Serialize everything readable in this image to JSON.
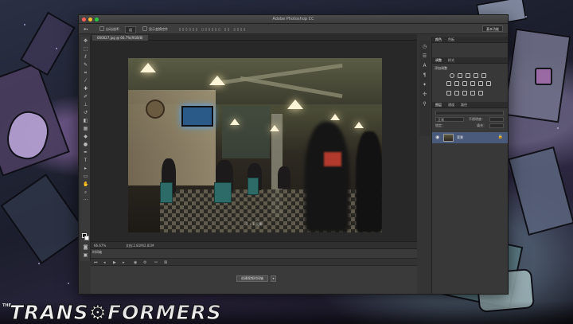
{
  "app": {
    "title": "Adobe Photoshop CC"
  },
  "options_bar": {
    "auto_select_label": "自动选择：",
    "auto_select_value": "组",
    "show_transform_label": "显示变换控件",
    "workspace_label": "基本功能"
  },
  "document": {
    "tab_label": "000027.jpg @ 66.7%(RGB/8)",
    "watermark": "1 + 1 风景"
  },
  "status": {
    "zoom": "66.67%",
    "doc_size": "文档:2.81M/2.81M"
  },
  "timeline": {
    "title": "时间轴",
    "create_button_label": "创建视频时间轴"
  },
  "panels": {
    "top_tabs": [
      "颜色",
      "色板"
    ],
    "mid_tabs": [
      "调整",
      "样式"
    ],
    "adjust_title": "添加调整",
    "layer_tabs": [
      "图层",
      "通道",
      "路径"
    ],
    "blend_mode": "正常",
    "opacity_label": "不透明度：",
    "lock_label": "锁定：",
    "fill_label": "填充：",
    "layer_name": "背景"
  },
  "colors": {
    "accent": "#4a5a7a",
    "panel": "#383838",
    "chrome": "#343434"
  },
  "desktop": {
    "brand": "TRANS⚙FORMERS",
    "the": "THE"
  }
}
